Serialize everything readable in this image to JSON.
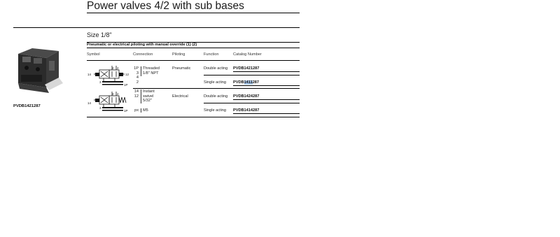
{
  "title": "Power valves 4/2 with sub bases",
  "size_label": "Size 1/8\"",
  "caption": "Pneumatic or electrical piloting with manual override (1) (2)",
  "product_label": "PVDB1421287",
  "table": {
    "headers": [
      "Symbol",
      "Connection",
      "Piloting",
      "Function",
      "Catalog Number"
    ],
    "groups": [
      {
        "symbol_labels": {
          "port4": "4",
          "port2": "2",
          "port14": "14",
          "port12": "12",
          "port3": "3",
          "port1p": "1P"
        },
        "connection_ports": [
          "1P",
          "3",
          "4",
          "2"
        ],
        "connection_desc": [
          "Threaded",
          "1/8\" NPT"
        ],
        "piloting": "Pneumatic",
        "rows": [
          {
            "function": "Double acting",
            "catalog": "PVDB1421287"
          },
          {
            "function": "Single acting",
            "catalog_pre": "PVDB",
            "catalog_hl": "1411",
            "catalog_post": "287"
          }
        ]
      },
      {
        "symbol_labels": {
          "port4": "4",
          "port2": "2",
          "port14": "14",
          "port3": "3",
          "port1p": "1P"
        },
        "connection_ports": [
          "14",
          "12"
        ],
        "connection_desc": [
          "Instant",
          "swivel",
          "5/32\""
        ],
        "piloting": "Electrical",
        "rows": [
          {
            "function": "Double acting",
            "catalog": "PVDB1424287"
          },
          {
            "function": "Single acting",
            "catalog": "PVDB1414287"
          }
        ]
      }
    ],
    "footer": {
      "port": "px",
      "connection": "M5"
    }
  }
}
